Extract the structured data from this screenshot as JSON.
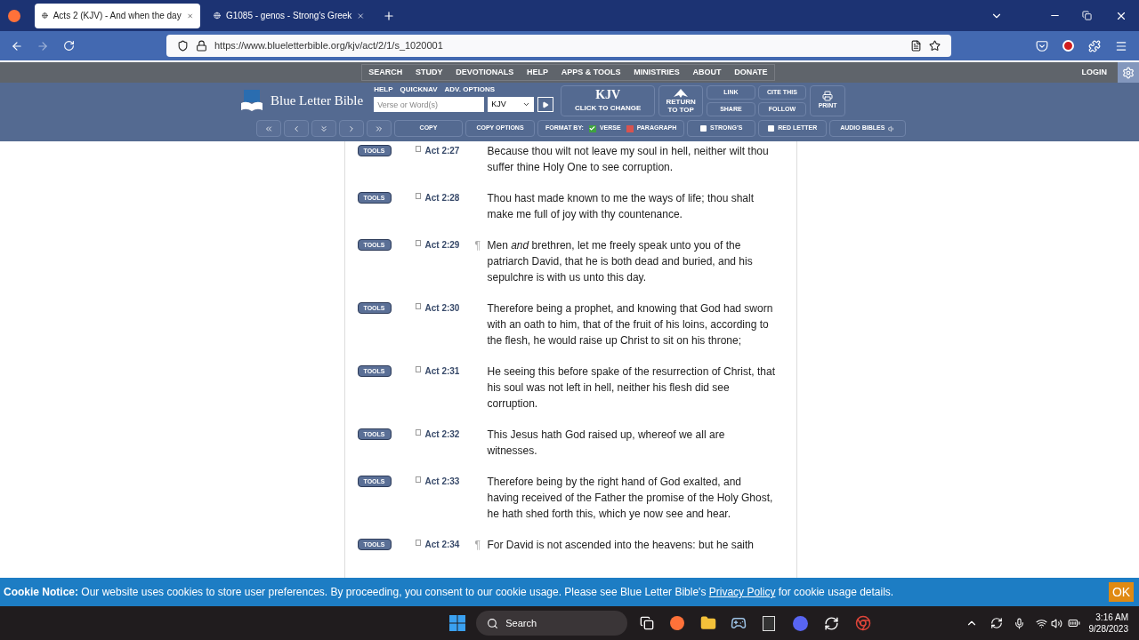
{
  "browser": {
    "tabs": [
      {
        "title": "Acts 2 (KJV) - And when the day",
        "selected": true
      },
      {
        "title": "G1085 - genos - Strong's Greek",
        "selected": false
      }
    ],
    "url": "https://www.blueletterbible.org/kjv/act/2/1/s_1020001"
  },
  "site": {
    "menu": [
      "SEARCH",
      "STUDY",
      "DEVOTIONALS",
      "HELP",
      "APPS & TOOLS",
      "MINISTRIES",
      "ABOUT",
      "DONATE"
    ],
    "login": "LOGIN",
    "logo": "Blue Letter Bible",
    "search_links": [
      "HELP",
      "QUICKNAV",
      "ADV. OPTIONS"
    ],
    "search": {
      "placeholder": "Verse or Word(s)"
    },
    "version": "KJV",
    "version_button": {
      "title": "KJV",
      "subtitle": "CLICK TO CHANGE"
    },
    "return_top": "RETURN TO TOP",
    "actions": [
      "LINK",
      "CITE THIS",
      "SHARE",
      "FOLLOW"
    ],
    "print": "PRINT",
    "copy": "COPY",
    "copy_options": "COPY OPTIONS",
    "format_label": "FORMAT BY:",
    "formats": [
      {
        "label": "VERSE",
        "checked": true
      },
      {
        "label": "PARAGRAPH",
        "checked": false
      }
    ],
    "toggles": [
      {
        "label": "STRONG'S",
        "checked": false
      },
      {
        "label": "RED LETTER",
        "checked": false
      }
    ],
    "audio": "AUDIO BIBLES"
  },
  "verses": [
    {
      "tools": "TOOLS",
      "ref": "Act 2:27",
      "text": "Because thou wilt not leave my soul in hell, neither wilt thou suffer thine Holy One to see corruption."
    },
    {
      "tools": "TOOLS",
      "ref": "Act 2:28",
      "text": "Thou hast made known to me the ways of life; thou shalt make me full of joy with thy countenance."
    },
    {
      "tools": "TOOLS",
      "ref": "Act 2:29",
      "mark": "¶",
      "text": "Men *and* brethren, let me freely speak unto you of the patriarch David, that he is both dead and buried, and his sepulchre is with us unto this day."
    },
    {
      "tools": "TOOLS",
      "ref": "Act 2:30",
      "text": "Therefore being a prophet, and knowing that God had sworn with an oath to him, that of the fruit of his loins, according to the flesh, he would raise up Christ to sit on his throne;"
    },
    {
      "tools": "TOOLS",
      "ref": "Act 2:31",
      "text": "He seeing this before spake of the resurrection of Christ, that his soul was not left in hell, neither his flesh did see corruption."
    },
    {
      "tools": "TOOLS",
      "ref": "Act 2:32",
      "text": "This Jesus hath God raised up, whereof we all are witnesses."
    },
    {
      "tools": "TOOLS",
      "ref": "Act 2:33",
      "text": "Therefore being by the right hand of God exalted, and having received of the Father the promise of the Holy Ghost, he hath shed forth this, which ye now see and hear."
    },
    {
      "tools": "TOOLS",
      "ref": "Act 2:34",
      "mark": "¶",
      "text": "For David is not ascended into the heavens: but he saith"
    }
  ],
  "cookie": {
    "label": "Cookie Notice:",
    "text": "Our website uses cookies to store user preferences. By proceeding, you consent to our cookie usage. Please see Blue Letter Bible's",
    "link": "Privacy Policy",
    "after": "for cookie usage details.",
    "ok": "OK"
  },
  "taskbar": {
    "search": "Search",
    "time": "3:16 AM",
    "date": "9/28/2023"
  }
}
